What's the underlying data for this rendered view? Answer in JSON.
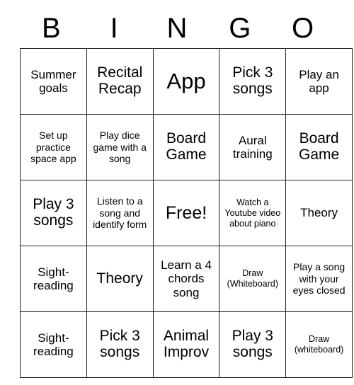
{
  "card": {
    "title_letters": [
      "B",
      "I",
      "N",
      "G",
      "O"
    ],
    "columns": 5,
    "rows": 5,
    "free_space": {
      "row": 3,
      "col": 3,
      "label": "Free!"
    },
    "colors": {
      "background": "#ffffff",
      "border": "#222222",
      "text": "#000000"
    },
    "cells": [
      [
        {
          "text": "Summer goals",
          "size": "m"
        },
        {
          "text": "Recital Recap",
          "size": "l"
        },
        {
          "text": "App",
          "size": "xxl"
        },
        {
          "text": "Pick 3 songs",
          "size": "l"
        },
        {
          "text": "Play an app",
          "size": "m"
        }
      ],
      [
        {
          "text": "Set up practice space app",
          "size": "s"
        },
        {
          "text": "Play dice game with a song",
          "size": "s"
        },
        {
          "text": "Board Game",
          "size": "l"
        },
        {
          "text": "Aural training",
          "size": "m"
        },
        {
          "text": "Board Game",
          "size": "l"
        }
      ],
      [
        {
          "text": "Play 3 songs",
          "size": "l"
        },
        {
          "text": "Listen to a song and identify form",
          "size": "s"
        },
        {
          "text": "Free!",
          "size": "xl"
        },
        {
          "text": "Watch a Youtube video about piano",
          "size": "xs"
        },
        {
          "text": "Theory",
          "size": "m"
        }
      ],
      [
        {
          "text": "Sight-reading",
          "size": "m"
        },
        {
          "text": "Theory",
          "size": "l"
        },
        {
          "text": "Learn a 4 chords song",
          "size": "m"
        },
        {
          "text": "Draw (Whiteboard)",
          "size": "xs"
        },
        {
          "text": "Play a song with your eyes closed",
          "size": "s"
        }
      ],
      [
        {
          "text": "Sight-reading",
          "size": "m"
        },
        {
          "text": "Pick 3 songs",
          "size": "l"
        },
        {
          "text": "Animal Improv",
          "size": "l"
        },
        {
          "text": "Play 3 songs",
          "size": "l"
        },
        {
          "text": "Draw (whiteboard)",
          "size": "xs"
        }
      ]
    ]
  }
}
